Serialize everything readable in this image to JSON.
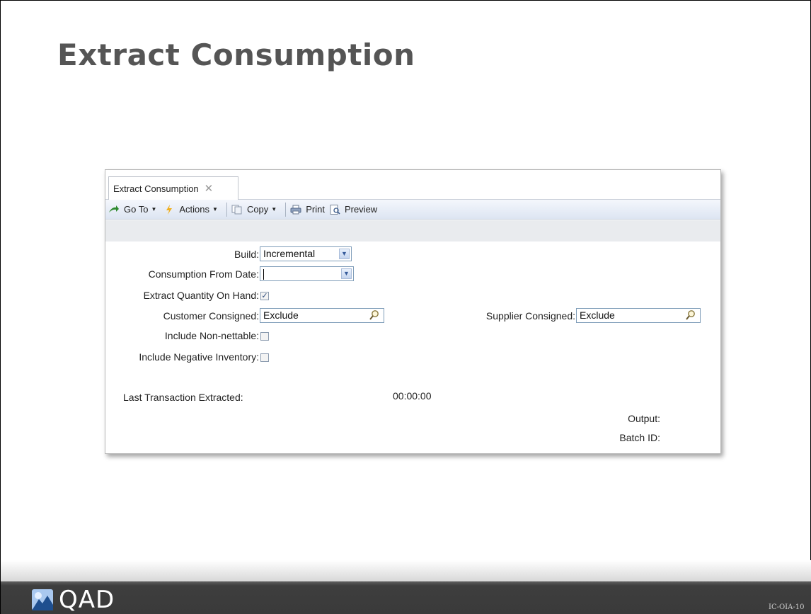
{
  "slide": {
    "title": "Extract Consumption",
    "code": "IC-OIA-10",
    "logo_text": "QAD"
  },
  "window": {
    "tab_label": "Extract Consumption",
    "tab_close": "✕",
    "toolbar": {
      "goto": "Go To",
      "actions": "Actions",
      "copy": "Copy",
      "print": "Print",
      "preview": "Preview"
    }
  },
  "form": {
    "build_label": "Build:",
    "build_value": "Incremental",
    "consumption_from_date_label": "Consumption From Date:",
    "consumption_from_date_value": "",
    "extract_qoh_label": "Extract Quantity On Hand:",
    "extract_qoh_checked": true,
    "customer_consigned_label": "Customer Consigned:",
    "customer_consigned_value": "Exclude",
    "supplier_consigned_label": "Supplier Consigned:",
    "supplier_consigned_value": "Exclude",
    "include_non_nettable_label": "Include Non-nettable:",
    "include_non_nettable_checked": false,
    "include_negative_inventory_label": "Include Negative Inventory:",
    "include_negative_inventory_checked": false,
    "last_transaction_label": "Last Transaction Extracted:",
    "last_transaction_time": "00:00:00",
    "output_label": "Output:",
    "batch_id_label": "Batch ID:"
  },
  "icons": {
    "goto": "arrow-right-icon",
    "actions": "lightning-icon",
    "copy": "copy-icon",
    "print": "printer-icon",
    "preview": "preview-icon",
    "lookup": "magnifier-icon",
    "dropdown": "chevron-down-icon"
  }
}
